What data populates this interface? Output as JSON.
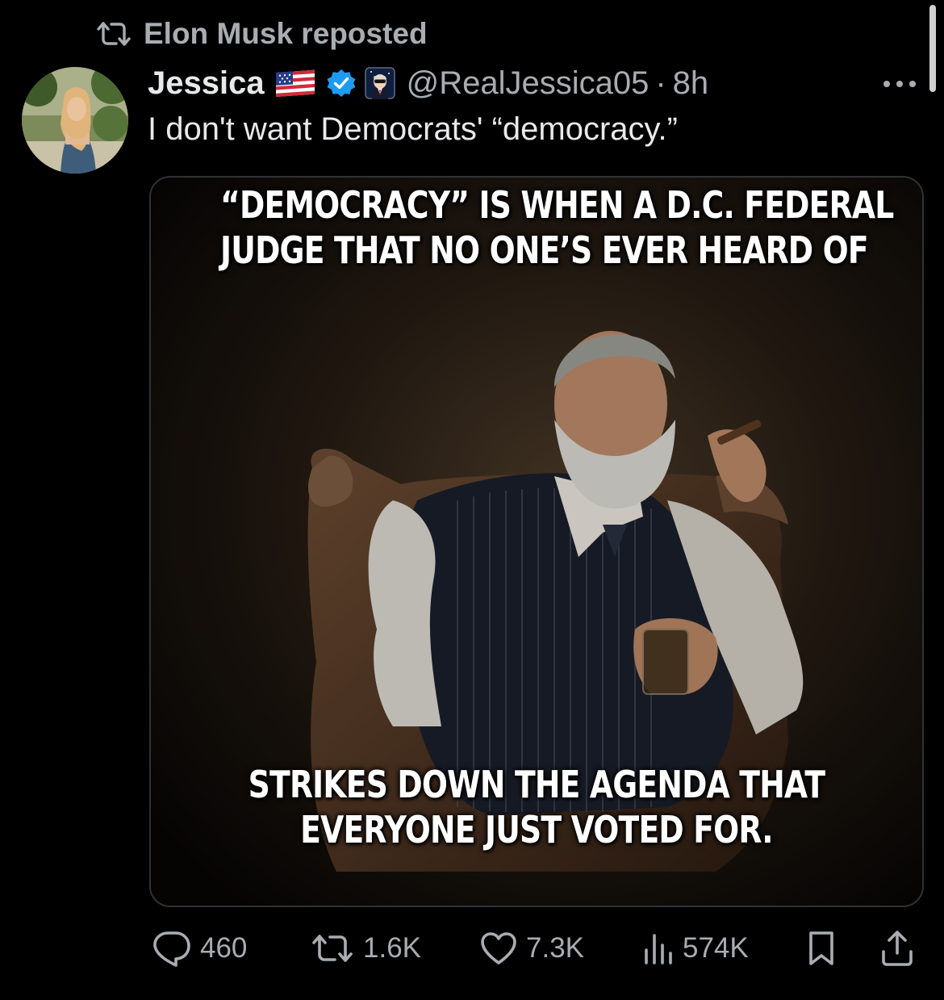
{
  "repost": {
    "text": "Elon Musk reposted",
    "icon": "repost-icon"
  },
  "tweet": {
    "author": {
      "display_name": "Jessica",
      "handle": "@RealJessica05",
      "flag": "us-flag-icon",
      "verified": "verified-badge-icon",
      "affiliate": "affiliate-badge-icon"
    },
    "separator": "·",
    "time": "8h",
    "text": "I don't want Democrats' “democracy.”",
    "media": {
      "top_caption": [
        "“DEMOCRACY” IS WHEN A D.C. FEDERAL",
        "JUDGE THAT NO ONE’S EVER HEARD OF"
      ],
      "bottom_caption": [
        "STRIKES DOWN THE AGENDA THAT",
        "EVERYONE JUST VOTED FOR."
      ]
    }
  },
  "actions": {
    "replies": "460",
    "reposts": "1.6K",
    "likes": "7.3K",
    "views": "574K"
  },
  "colors": {
    "background": "#000000",
    "primary_text": "#e7e9ea",
    "secondary_text": "#a8adb2",
    "verified_blue": "#1d9bf0"
  }
}
